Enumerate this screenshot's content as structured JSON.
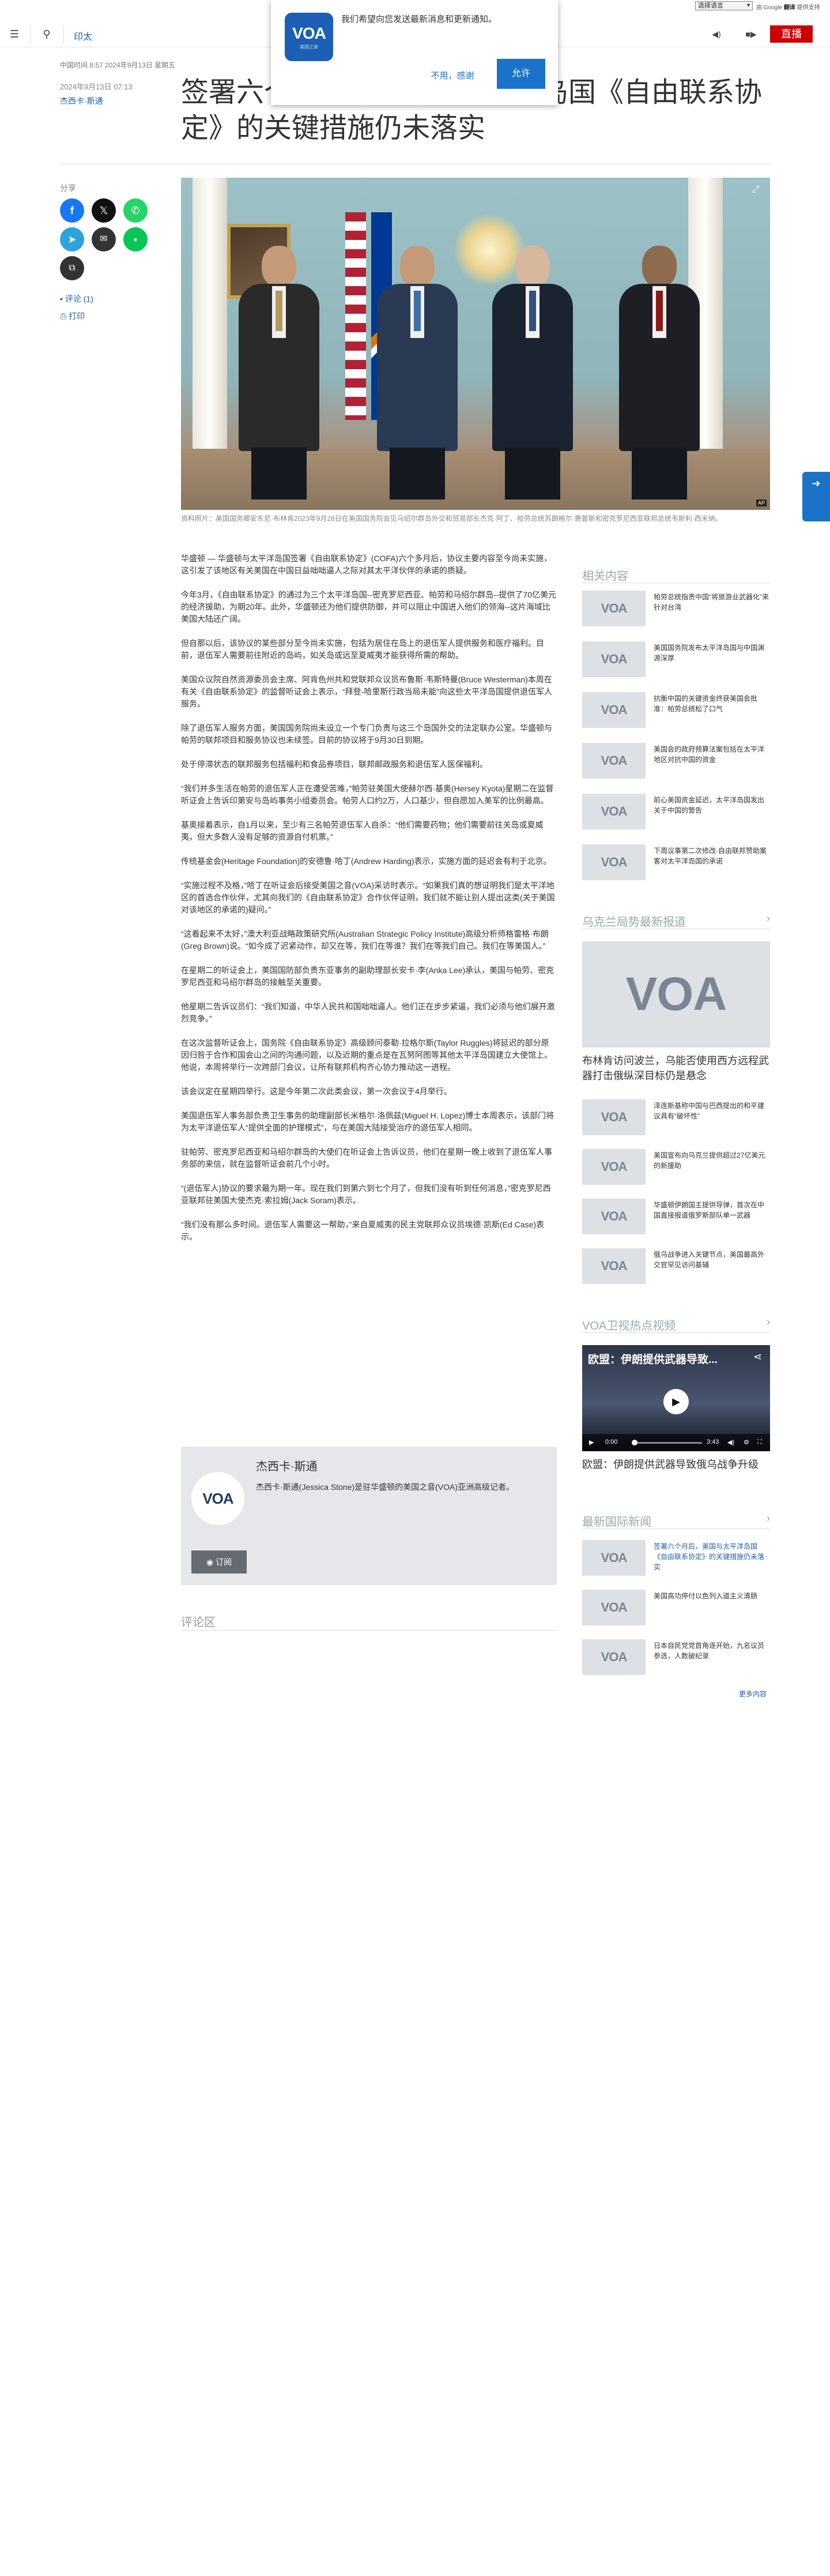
{
  "lang_select": "选择语言",
  "google_translate": {
    "prefix": "由 Google",
    "brand": "翻译",
    "suffix": "提供支持"
  },
  "header": {
    "section": "印太",
    "live": "直播"
  },
  "popup": {
    "logo_text": "VOA",
    "logo_sub": "美国之音",
    "message": "我们希望向您发送最新消息和更新通知。",
    "decline": "不用，感谢",
    "accept": "允许"
  },
  "meta": {
    "updated": "中国时间 8:57 2024年9月13日 星期五",
    "published": "2024年9月13日 07:13",
    "author": "杰西卡·斯通"
  },
  "title": "签署六个月后，美国与太平洋岛国《自由联系协定》的关键措施仍未落实",
  "share": {
    "label": "分享",
    "comments": "评论 (1)",
    "print": "打印"
  },
  "hero": {
    "af": "AP",
    "caption": "资料照片：美国国务卿安东尼·布林肯2023年9月28日在美国国务院会见马绍尔群岛外交和贸易部长杰克·阿丁、帕劳总统苏朗格尔·惠普斯和密克罗尼西亚联邦总统韦斯利·西米纳。"
  },
  "article": {
    "paragraphs": [
      "华盛顿 — 华盛顿与太平洋岛国签署《自由联系协定》(COFA)六个多月后，协议主要内容至今尚未实施，这引发了该地区有关美国在中国日益咄咄逼人之际对其太平洋伙伴的承诺的质疑。",
      "今年3月，《自由联系协定》的通过为三个太平洋岛国--密克罗尼西亚、帕劳和马绍尔群岛--提供了70亿美元的经济援助，为期20年。此外，华盛顿还为他们提供防御，并可以阻止中国进入他们的领海--这片海域比美国大陆还广阔。",
      "但自那以后，该协议的某些部分至今尚未实施，包括为居住在岛上的退伍军人提供服务和医疗福利。目前，退伍军人需要前往附近的岛屿，如关岛或远至夏威夷才能获得所需的帮助。",
      "美国众议院自然资源委员会主席、阿肯色州共和党联邦众议员布鲁斯·韦斯特曼(Bruce Westerman)本周在有关《自由联系协定》的监督听证会上表示，“拜登-哈里斯行政当局未能”向这些太平洋岛国提供退伍军人服务。",
      "除了退伍军人服务方面，美国国务院尚未设立一个专门负责与这三个岛国外交的法定联办公室。华盛顿与帕劳的联邦项目和服务协议也未续签。目前的协议将于9月30日到期。",
      "处于停滞状态的联邦服务包括福利和食品券项目，联邦邮政服务和退伍军人医保福利。",
      "“我们并多生活在帕劳的退伍军人正在遭受苦难，”帕劳驻美国大使赫尔西·基奥(Hersey Kyota)星期二在监督听证会上告诉印第安与岛屿事务小组委员会。帕劳人口约2万，人口基少，但自愿加入美军的比例最高。",
      "基奥接着表示，自1月以来，至少有三名帕劳退伍军人自杀：“他们需要药物；他们需要前往关岛或夏威夷，但大多数人没有足够的资源自付机票。”",
      "传统基金会(Heritage Foundation)的安德鲁·哈丁(Andrew Harding)表示，实施方面的延迟会有利于北京。",
      "“实施过程不及格，”哈丁在听证会后接受美国之音(VOA)采访时表示。“如果我们真的想证明我们是太平洋地区的首选合作伙伴，尤其向我们的《自由联系协定》合作伙伴证明，我们就不能让别人提出这类(关于美国对该地区的承诺的)疑问。”",
      "“这看起来不太好，”澳大利亚战略政策研究所(Australian Strategic Policy Institute)高级分析师格雷格·布朗(Greg Brown)说。“如今成了迟紧动作，却又在等，我们在等谁？我们在等我们自己。我们在等美国人。”",
      "在星期二的听证会上，美国国防部负责东亚事务的副助理部长安卡·李(Anka Lee)承认，美国与帕劳、密克罗尼西亚和马绍尔群岛的接触至关重要。",
      "他星期二告诉议员们：“我们知道，中华人民共和国咄咄逼人。他们正在步步紧逼，我们必须与他们展开激烈竞争。”",
      "在这次监督听证会上，国务院《自由联系协定》高级顾问泰勒·拉格尔斯(Taylor Ruggles)将延迟的部分原因归咎于合作和国会山之间的沟通问题，以及近期的重点是在瓦努阿图等其他太平洋岛国建立大使馆上。他说，本周将举行一次跨部门会议，让所有联邦机构齐心协力推动这一进程。",
      "该会议定在星期四举行。这是今年第二次此类会议，第一次会议于4月举行。",
      "美国退伍军人事务部负责卫生事务的助理副部长米格尔·洛佩兹(Miguel H. Lopez)博士本周表示，该部门将为太平洋退伍军人“提供全面的护理模式”，与在美国大陆接受治疗的退伍军人相同。",
      "驻帕劳、密克罗尼西亚和马绍尔群岛的大使们在听证会上告诉议员，他们在星期一晚上收到了退伍军人事务部的来信，就在监督听证会前几个小时。",
      "“(退伍军人)协议的要求最为期一年。现在我们到第六到七个月了，但我们没有听到任何消息，”密克罗尼西亚联邦驻美国大使杰克·索拉姆(Jack Soram)表示。",
      "“我们没有那么多时间。退伍军人需要这一帮助，”来自夏威夷的民主党联邦众议员埃德·凯斯(Ed Case)表示。"
    ]
  },
  "author_box": {
    "name": "杰西卡·斯通",
    "bio": "杰西卡·斯通(Jessica Stone)是驻华盛顿的美国之音(VOA)亚洲高级记者。",
    "subscribe": "订阅",
    "logo_text": "VOA"
  },
  "comments_title": "评论区",
  "sidebar": {
    "related_heading": "相关内容",
    "related": [
      "帕劳总统指责中国“将旅游业武器化”来针对台湾",
      "美国国务院发布太平洋岛国与中国渊源深厚",
      "抗衡中国的关键资金终获美国会批准：帕劳总统松了口气",
      "美国会的政府预算法案包括在太平洋地区对抗中国的资金",
      "前心美国资金延迟，太平洋岛国发出关于中国的警告",
      "下周议事第二次修改·自由联邦赞助案客对太平洋岛国的承诺"
    ],
    "ukraine_heading": "乌克兰局势最新报道",
    "ukraine_feature": "布林肯访问波兰，乌能否使用西方远程武器打击俄纵深目标仍是悬念",
    "ukraine": [
      "泽连斯基称中国与巴西提出的和平建议具有“破坏性”",
      "美国宣布向乌克兰提供超过27亿美元的新援助",
      "华盛顿伊朗国主提供导弹，首次在中国直接报道俄罗斯部队单一武器",
      "俄乌战争进入关键节点，美国最高外交官罕见访问基辅"
    ],
    "video_heading": "VOA卫视热点视频",
    "video": {
      "title": "欧盟：伊朗提供武器导致...",
      "time_current": "0:00",
      "time_total": "3:43",
      "caption": "欧盟：伊朗提供武器导致俄乌战争升级"
    },
    "intl_heading": "最新国际新闻",
    "intl": [
      "签署六个月后，美国与太平洋岛国《自由联系协定》的关键措施仍未落实",
      "美国高功停付以色列入道主义清肠",
      "日本自民党党首角逐开始，九名议员参选，人数破纪录"
    ],
    "more": "更多内容",
    "thumb_text": "VOA"
  }
}
